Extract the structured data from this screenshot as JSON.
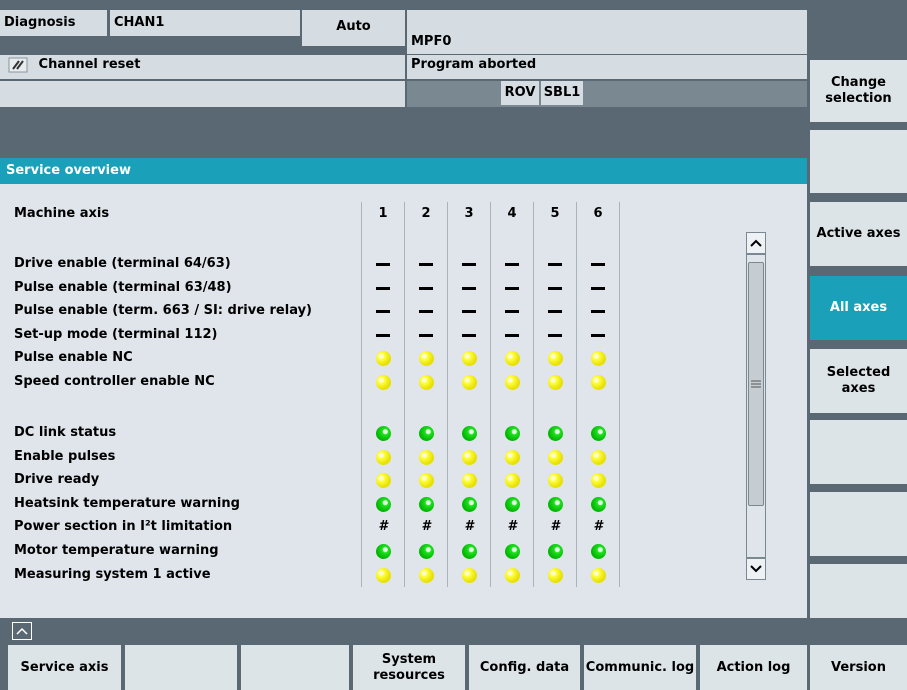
{
  "header": {
    "area": "Diagnosis",
    "channel": "CHAN1",
    "mode": "Auto",
    "program": "MPF0",
    "channel_status": "Channel reset",
    "program_status": "Program aborted",
    "indicators": [
      "ROV",
      "SBL1"
    ]
  },
  "panel": {
    "title": "Service overview",
    "row_header": "Machine axis",
    "axes": [
      "1",
      "2",
      "3",
      "4",
      "5",
      "6"
    ],
    "rows_group1": [
      {
        "label": "Drive enable (terminal 64/63)",
        "state": "dash"
      },
      {
        "label": "Pulse enable (terminal 63/48)",
        "state": "dash"
      },
      {
        "label": "Pulse enable (term. 663 / SI: drive relay)",
        "state": "dash"
      },
      {
        "label": "Set-up mode (terminal 112)",
        "state": "dash"
      },
      {
        "label": "Pulse enable NC",
        "state": "yellow"
      },
      {
        "label": "Speed controller enable NC",
        "state": "yellow"
      }
    ],
    "rows_group2": [
      {
        "label": "DC link status",
        "state": "green"
      },
      {
        "label": "Enable pulses",
        "state": "yellow"
      },
      {
        "label": "Drive ready",
        "state": "yellow"
      },
      {
        "label": "Heatsink temperature warning",
        "state": "green"
      },
      {
        "label": "Power section in I²t limitation",
        "state": "hash",
        "symbol": "#"
      },
      {
        "label": "Motor temperature warning",
        "state": "green"
      },
      {
        "label": "Measuring system 1 active",
        "state": "yellow"
      }
    ]
  },
  "softkeys_right": [
    {
      "label": "",
      "active": false
    },
    {
      "label": "Change selection",
      "active": false
    },
    {
      "label": "",
      "active": false
    },
    {
      "label": "Active axes",
      "active": false
    },
    {
      "label": "All axes",
      "active": true
    },
    {
      "label": "Selected axes",
      "active": false
    },
    {
      "label": "",
      "active": false
    },
    {
      "label": "",
      "active": false
    },
    {
      "label": "",
      "active": false
    }
  ],
  "softkeys_bottom": [
    "Service axis",
    "",
    "",
    "System resources",
    "Config. data",
    "Communic. log",
    "Action log"
  ],
  "version_label": "Version",
  "colors": {
    "accent": "#1aa0b8",
    "led_yellow": "#f2ee00",
    "led_green": "#00c000"
  }
}
